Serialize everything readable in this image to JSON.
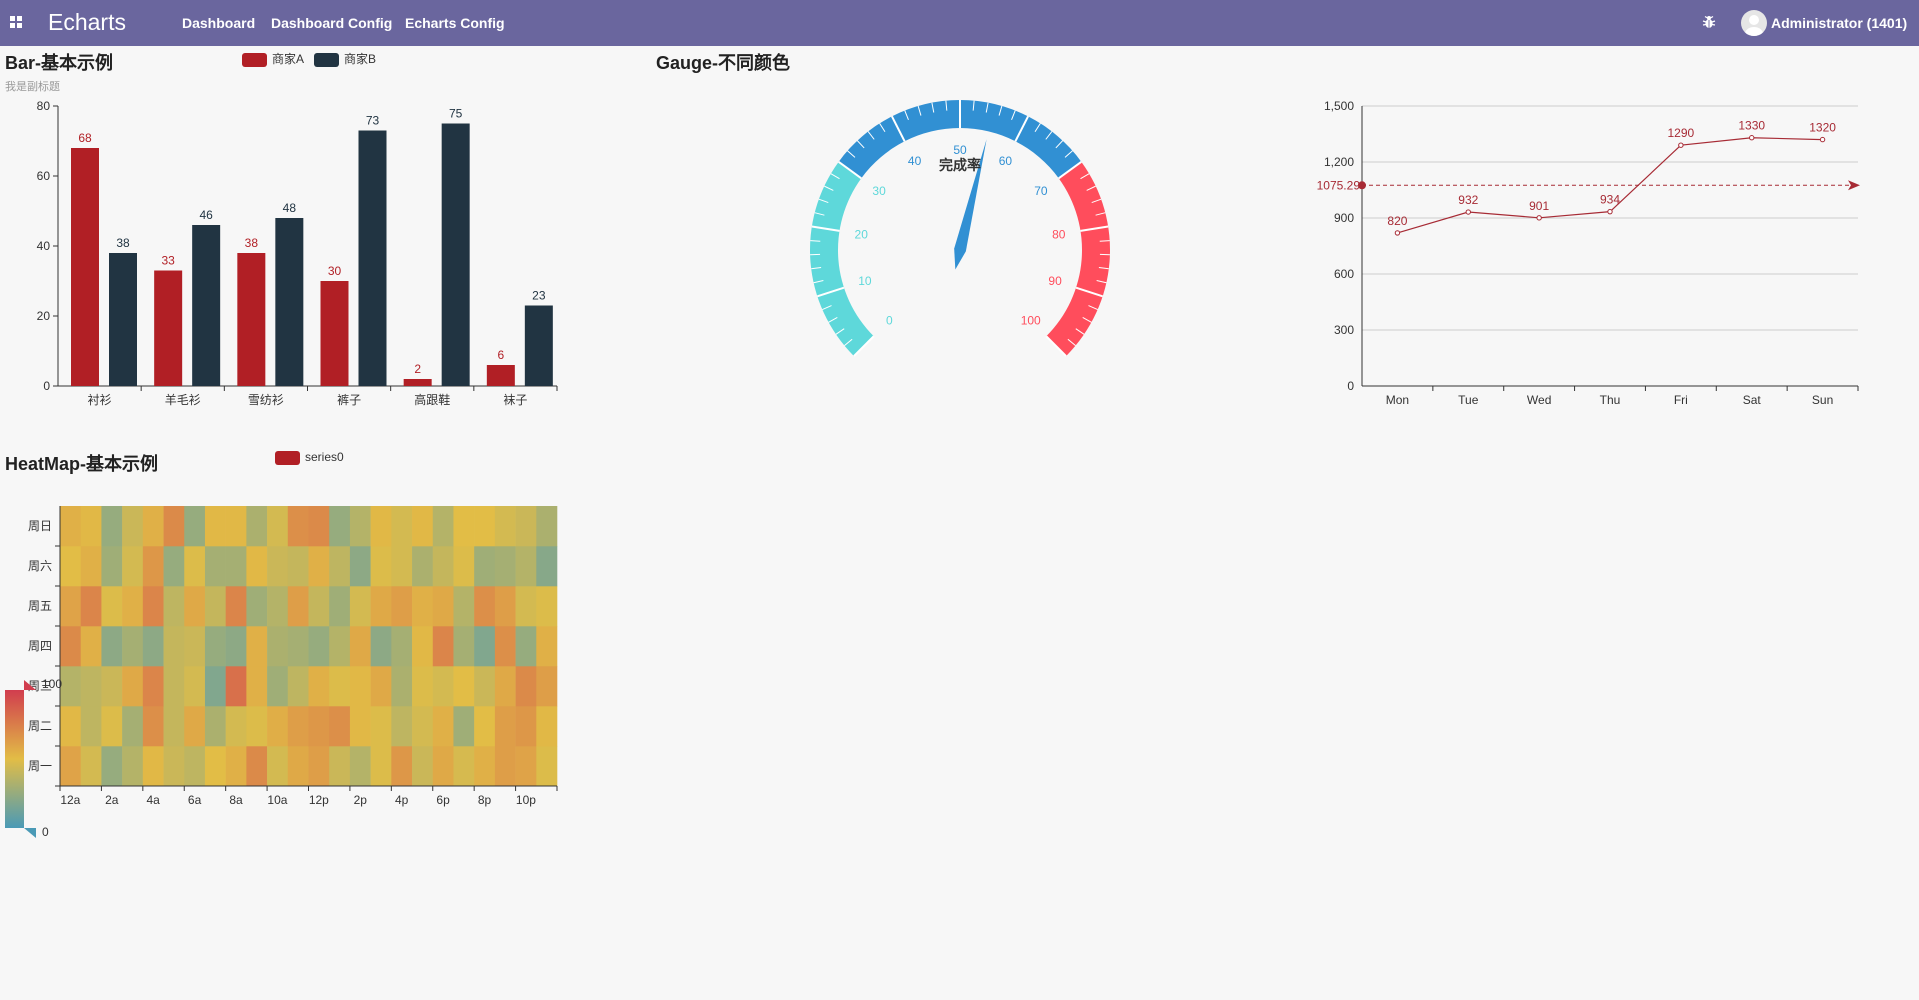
{
  "header": {
    "app_title": "Echarts",
    "nav": [
      "Dashboard",
      "Dashboard Config",
      "Echarts Config"
    ],
    "user": "Administrator (1401)",
    "icons": [
      "apps-icon",
      "bug-icon",
      "avatar"
    ]
  },
  "bar_panel": {
    "title": "Bar-基本示例",
    "subtitle": "我是副标题"
  },
  "gauge_panel": {
    "title": "Gauge-不同颜色"
  },
  "heatmap_panel": {
    "title": "HeatMap-基本示例"
  },
  "chart_data": [
    {
      "type": "bar",
      "title": "Bar-基本示例",
      "subtitle": "我是副标题",
      "categories": [
        "衬衫",
        "羊毛衫",
        "雪纺衫",
        "裤子",
        "高跟鞋",
        "袜子"
      ],
      "series": [
        {
          "name": "商家A",
          "values": [
            68,
            33,
            38,
            30,
            2,
            6
          ],
          "color": "#b11f25"
        },
        {
          "name": "商家B",
          "values": [
            38,
            46,
            48,
            73,
            75,
            23
          ],
          "color": "#213442"
        }
      ],
      "yticks": [
        0,
        20,
        40,
        60,
        80
      ],
      "ylim": [
        0,
        80
      ],
      "legend": "top",
      "grid": false
    },
    {
      "type": "gauge",
      "title": "Gauge-不同颜色",
      "label": "完成率",
      "value": 55,
      "min": 0,
      "max": 100,
      "tick_labels": [
        0,
        10,
        20,
        30,
        40,
        50,
        60,
        70,
        80,
        90,
        100
      ],
      "color_bands": [
        {
          "to": 0.3,
          "color": "#5ed8da"
        },
        {
          "to": 0.7,
          "color": "#3190d3"
        },
        {
          "to": 1.0,
          "color": "#ff4d5c"
        }
      ]
    },
    {
      "type": "line",
      "categories": [
        "Mon",
        "Tue",
        "Wed",
        "Thu",
        "Fri",
        "Sat",
        "Sun"
      ],
      "series": [
        {
          "values": [
            820,
            932,
            901,
            934,
            1290,
            1330,
            1320
          ],
          "color": "#a72b35"
        }
      ],
      "mark_line": {
        "value": 1075.29,
        "label": "1075.29"
      },
      "yticks": [
        0,
        300,
        600,
        900,
        1200,
        1500
      ],
      "ytick_labels": [
        "0",
        "300",
        "600",
        "900",
        "1,200",
        "1,500"
      ],
      "ylim": [
        0,
        1500
      ],
      "grid": true
    },
    {
      "type": "heatmap",
      "title": "HeatMap-基本示例",
      "legend": [
        "series0"
      ],
      "x": [
        "12a",
        "1a",
        "2a",
        "3a",
        "4a",
        "5a",
        "6a",
        "7a",
        "8a",
        "9a",
        "10a",
        "11a",
        "12p",
        "1p",
        "2p",
        "3p",
        "4p",
        "5p",
        "6p",
        "7p",
        "8p",
        "9p",
        "10p",
        "11p"
      ],
      "xtick_labels": [
        "12a",
        "2a",
        "4a",
        "6a",
        "8a",
        "10a",
        "12p",
        "2p",
        "4p",
        "6p",
        "8p",
        "10p"
      ],
      "y": [
        "周一",
        "周二",
        "周三",
        "周四",
        "周五",
        "周六",
        "周日"
      ],
      "visual_map": {
        "min": 0,
        "max": 100,
        "max_label": "100",
        "min_label": "0",
        "colors": [
          "#4a9ab6",
          "#e2bd46",
          "#d13d4e"
        ]
      },
      "values": [
        [
          60,
          45,
          25,
          35,
          52,
          42,
          38,
          50,
          55,
          70,
          45,
          58,
          62,
          42,
          35,
          48,
          65,
          42,
          58,
          46,
          55,
          62,
          60,
          48
        ],
        [
          52,
          38,
          48,
          30,
          68,
          40,
          58,
          32,
          45,
          48,
          56,
          62,
          65,
          68,
          52,
          48,
          38,
          45,
          55,
          28,
          50,
          62,
          65,
          52
        ],
        [
          35,
          38,
          42,
          58,
          72,
          40,
          45,
          18,
          80,
          55,
          28,
          38,
          55,
          48,
          52,
          58,
          32,
          48,
          45,
          50,
          42,
          58,
          70,
          62
        ],
        [
          70,
          55,
          22,
          30,
          22,
          40,
          42,
          25,
          22,
          55,
          32,
          30,
          25,
          35,
          58,
          22,
          30,
          52,
          72,
          30,
          18,
          68,
          25,
          55
        ],
        [
          60,
          72,
          48,
          55,
          72,
          38,
          58,
          40,
          72,
          28,
          35,
          62,
          40,
          28,
          45,
          58,
          62,
          55,
          58,
          35,
          68,
          62,
          45,
          48
        ],
        [
          50,
          55,
          28,
          45,
          65,
          25,
          48,
          30,
          30,
          52,
          42,
          40,
          55,
          38,
          22,
          48,
          45,
          32,
          40,
          48,
          28,
          30,
          35,
          20
        ],
        [
          55,
          52,
          25,
          42,
          55,
          70,
          25,
          52,
          52,
          32,
          45,
          68,
          70,
          25,
          35,
          52,
          45,
          52,
          35,
          50,
          50,
          45,
          42,
          32
        ]
      ]
    }
  ]
}
